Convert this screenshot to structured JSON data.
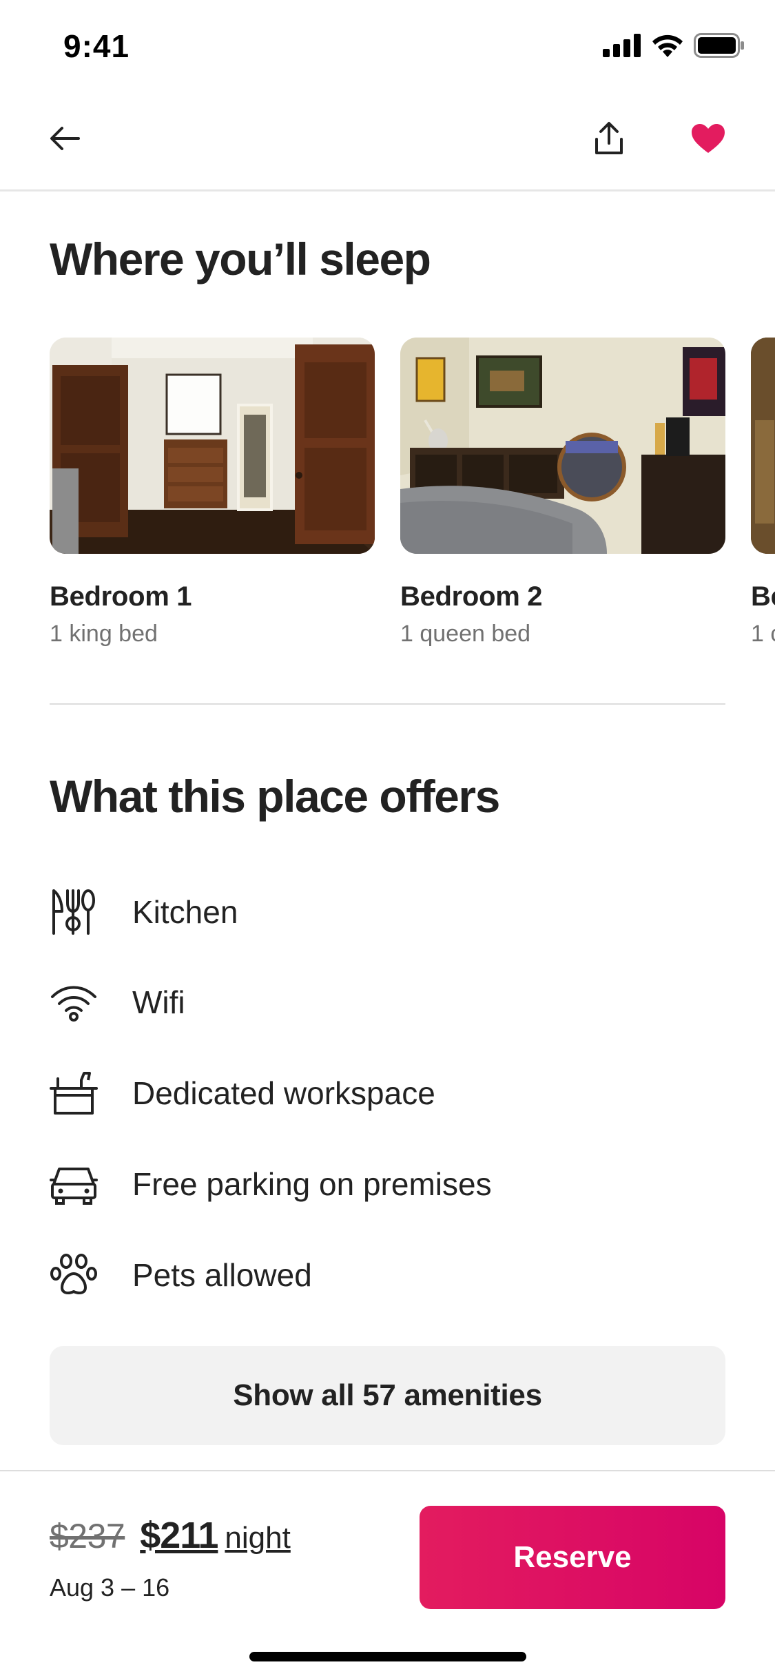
{
  "status_bar": {
    "time": "9:41",
    "icons": [
      "cellular-signal-icon",
      "wifi-icon",
      "battery-icon"
    ]
  },
  "nav": {
    "icons": [
      "back-arrow-icon",
      "share-icon",
      "heart-icon"
    ],
    "heart_color": "#E31C5F"
  },
  "sleep": {
    "title": "Where you’ll sleep",
    "bedrooms": [
      {
        "name": "Bedroom 1",
        "beds": "1 king bed"
      },
      {
        "name": "Bedroom 2",
        "beds": "1 queen bed"
      },
      {
        "name": "Be",
        "beds": "1 c"
      }
    ]
  },
  "offers": {
    "title": "What this place offers",
    "amenities": [
      {
        "label": "Kitchen",
        "icon": "kitchen-icon"
      },
      {
        "label": "Wifi",
        "icon": "wifi-icon"
      },
      {
        "label": "Dedicated workspace",
        "icon": "workspace-icon"
      },
      {
        "label": "Free parking on premises",
        "icon": "car-icon"
      },
      {
        "label": "Pets allowed",
        "icon": "paw-icon"
      }
    ],
    "show_all_label": "Show all 57 amenities"
  },
  "footer": {
    "old_price": "$237",
    "new_price": "$211",
    "price_unit": "night",
    "dates": "Aug 3 – 16",
    "reserve_label": "Reserve"
  },
  "colors": {
    "brand": "#E31C5F",
    "text": "#222222",
    "secondary_text": "#717171",
    "divider": "#DDDDDD",
    "button_bg": "#F2F2F2"
  }
}
